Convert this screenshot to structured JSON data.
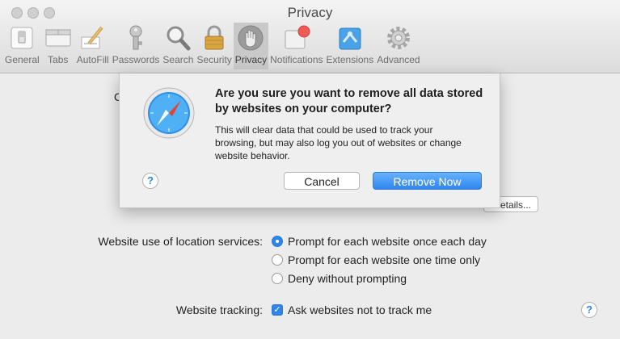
{
  "window": {
    "title": "Privacy"
  },
  "toolbar": {
    "items": [
      {
        "label": "General",
        "icon": "switch-icon"
      },
      {
        "label": "Tabs",
        "icon": "tabs-icon"
      },
      {
        "label": "AutoFill",
        "icon": "pencil-icon"
      },
      {
        "label": "Passwords",
        "icon": "key-icon"
      },
      {
        "label": "Search",
        "icon": "magnifier-icon"
      },
      {
        "label": "Security",
        "icon": "lock-icon"
      },
      {
        "label": "Privacy",
        "icon": "hand-icon",
        "active": true
      },
      {
        "label": "Notifications",
        "icon": "notifications-icon"
      },
      {
        "label": "Extensions",
        "icon": "puzzle-icon"
      },
      {
        "label": "Advanced",
        "icon": "gear-icon"
      }
    ]
  },
  "sheet": {
    "heading": "Are you sure you want to remove all data stored by websites on your computer?",
    "body": "This will clear data that could be used to track your browsing, but may also log you out of websites or change website behavior.",
    "cancel_label": "Cancel",
    "remove_label": "Remove Now",
    "help_label": "?"
  },
  "content": {
    "peek_letter": "C",
    "details_label": "etails...",
    "location_label": "Website use of location services:",
    "location_options": [
      {
        "label": "Prompt for each website once each day",
        "selected": true
      },
      {
        "label": "Prompt for each website one time only",
        "selected": false
      },
      {
        "label": "Deny without prompting",
        "selected": false
      }
    ],
    "tracking_label": "Website tracking:",
    "tracking_option": {
      "label": "Ask websites not to track me",
      "checked": true
    },
    "help_label": "?"
  },
  "colors": {
    "accent": "#2f86e8",
    "window_bg": "#ececec"
  }
}
